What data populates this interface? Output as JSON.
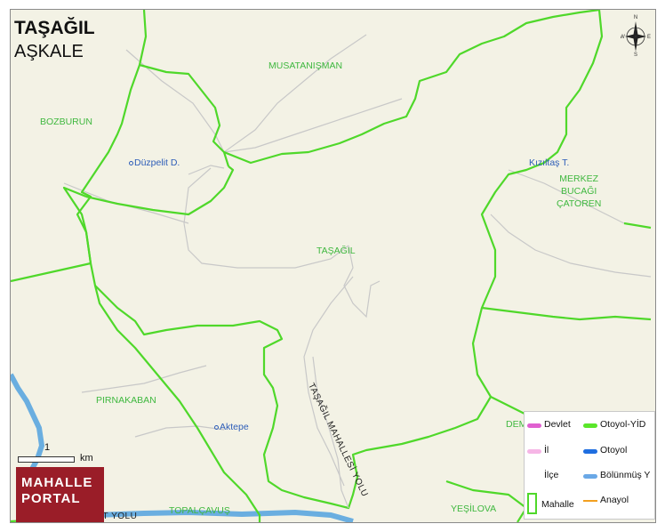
{
  "header": {
    "title": "TAŞAĞIL",
    "subtitle": "AŞKALE"
  },
  "regions": [
    {
      "id": "musataniman",
      "text": "MUSATANIŞMAN"
    },
    {
      "id": "bozburun",
      "text": "BOZBURUN"
    },
    {
      "id": "merkez",
      "text": "MERKEZ\nBUCAĞI\nÇATOREN"
    },
    {
      "id": "tasagil",
      "text": "TAŞAĞIL"
    },
    {
      "id": "pirnakaban",
      "text": "PIRNAKABAN"
    },
    {
      "id": "topalcavus",
      "text": "TOPALÇAVUŞ"
    },
    {
      "id": "yesilova",
      "text": "YEŞİLOVA"
    },
    {
      "id": "dem",
      "text": "DEM"
    }
  ],
  "places": [
    {
      "id": "duzpelit",
      "text": "Düzpelit D."
    },
    {
      "id": "kiziltas",
      "text": "Kızıltaş T."
    },
    {
      "id": "aktepe",
      "text": "Aktepe"
    }
  ],
  "roads": [
    {
      "id": "tasagil-yolu",
      "text": "TAŞAĞIL MAHALLESİ YOLU"
    },
    {
      "id": "bottom-road",
      "text": "RT YOLU"
    }
  ],
  "scale": {
    "value": "1",
    "unit": "km"
  },
  "logo": {
    "line1": "MAHALLE",
    "line2": "PORTAL"
  },
  "compass": {
    "n": "N",
    "s": "S",
    "e": "E",
    "w": "W"
  },
  "legend": {
    "items": [
      {
        "label": "Devlet",
        "color": "#e060d0"
      },
      {
        "label": "Otoyol-YİD",
        "color": "#5ae62a"
      },
      {
        "label": "İl",
        "color": "#f6b6e6"
      },
      {
        "label": "Otoyol",
        "color": "#1f6ee0"
      },
      {
        "label": "İlçe",
        "color": "#ffffff"
      },
      {
        "label": "Bölünmüş Y",
        "color": "#6aa8e6"
      },
      {
        "label": "Mahalle",
        "color": "#4fd82a"
      },
      {
        "label": "Anayol",
        "color": "#f2a020"
      }
    ]
  },
  "colors": {
    "map_bg": "#f3f2e5",
    "boundary": "#4fd82a",
    "minor_road": "#c8c8c8",
    "water": "#6aaee0",
    "place_text": "#2d5db8",
    "region_text": "#3fb83f"
  }
}
